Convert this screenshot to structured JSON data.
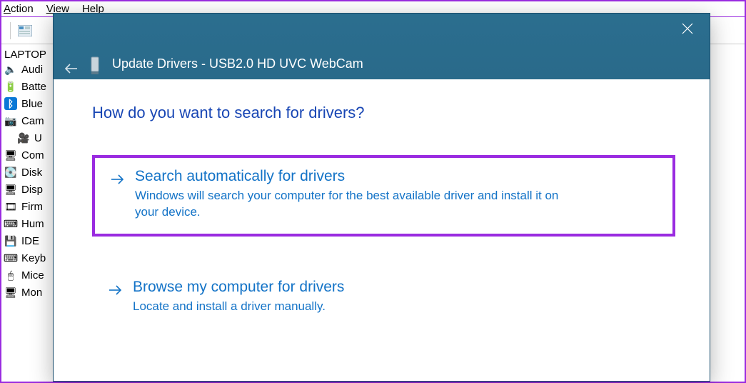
{
  "menubar": {
    "action": "Action",
    "view": "View",
    "help": "Help"
  },
  "tree": {
    "root": "LAPTOP",
    "items": [
      {
        "label": "Audi",
        "icon": "i-speaker"
      },
      {
        "label": "Batte",
        "icon": "i-battery"
      },
      {
        "label": "Blue",
        "icon": "i-bluetooth"
      },
      {
        "label": "Cam",
        "icon": "i-camera"
      },
      {
        "label": "U",
        "icon": "i-webcam",
        "indent": true
      },
      {
        "label": "Com",
        "icon": "i-monitor"
      },
      {
        "label": "Disk",
        "icon": "i-disk"
      },
      {
        "label": "Disp",
        "icon": "i-display"
      },
      {
        "label": "Firm",
        "icon": "i-film"
      },
      {
        "label": "Hum",
        "icon": "i-keyboard"
      },
      {
        "label": "IDE ",
        "icon": "i-ide"
      },
      {
        "label": "Keyb",
        "icon": "i-keyboard"
      },
      {
        "label": "Mice",
        "icon": "i-mouse"
      },
      {
        "label": "Mon",
        "icon": "i-chip"
      }
    ]
  },
  "dialog": {
    "title": "Update Drivers - USB2.0 HD UVC WebCam",
    "heading": "How do you want to search for drivers?",
    "option1": {
      "title": "Search automatically for drivers",
      "desc": "Windows will search your computer for the best available driver and install it on your device."
    },
    "option2": {
      "title": "Browse my computer for drivers",
      "desc": "Locate and install a driver manually."
    }
  }
}
